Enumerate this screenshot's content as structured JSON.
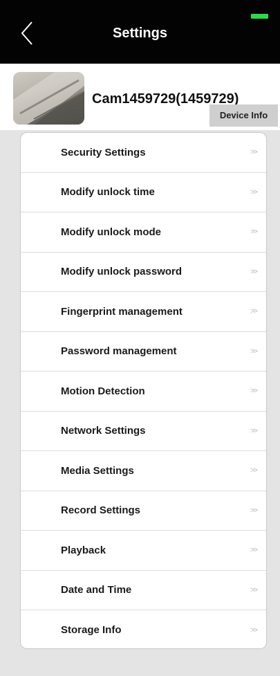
{
  "header": {
    "title": "Settings",
    "back_icon": "chevron-left-icon",
    "battery_color": "#2fd84a"
  },
  "device": {
    "name": "Cam1459729(1459729)",
    "info_button": "Device Info"
  },
  "menu": {
    "arrow": ">>",
    "items": [
      {
        "label": "Security Settings"
      },
      {
        "label": "Modify unlock time"
      },
      {
        "label": "Modify unlock mode"
      },
      {
        "label": "Modify unlock password"
      },
      {
        "label": "Fingerprint management"
      },
      {
        "label": "Password management"
      },
      {
        "label": "Motion Detection"
      },
      {
        "label": "Network Settings"
      },
      {
        "label": "Media Settings"
      },
      {
        "label": "Record Settings"
      },
      {
        "label": "Playback"
      },
      {
        "label": "Date and Time"
      },
      {
        "label": "Storage Info"
      }
    ]
  }
}
